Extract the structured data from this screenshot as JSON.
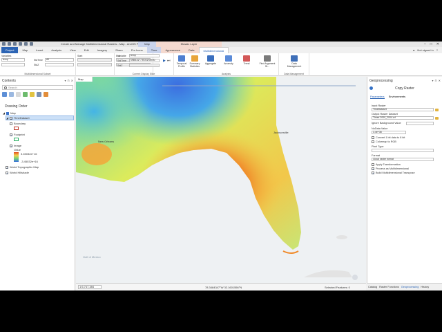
{
  "window": {
    "title": "Create and Manage Multidimensional Rasters - Map - ArcGIS Pro",
    "context_map": "Map",
    "context_mosaic": "Mosaic Layer",
    "controls": [
      "–",
      "□",
      "✕"
    ]
  },
  "tabs": [
    "Project",
    "Map",
    "Insert",
    "Analysis",
    "View",
    "Edit",
    "Imagery",
    "Share",
    "Pro Icons",
    "Time",
    "Appearance",
    "Data",
    "Multidimensional"
  ],
  "tabs_active": "Multidimensional",
  "user": "Not signed in",
  "ribbon": {
    "variables_label": "Variables",
    "variables_value": "temp",
    "stddim_label": "StdTime",
    "stddim_value": "All",
    "stdz_label": "StdZ",
    "start_label": "Start",
    "end_label": "End",
    "group_multidim": "Multidimensional Subset",
    "variable_label": "Variable",
    "variable_value": "temp",
    "time_label": "StdTime",
    "time_value": "1983-12 - 9/1/12:00:00",
    "stdz2_label": "StdZ",
    "group_current": "Current Display Slice",
    "buttons": [
      {
        "label": "Temporal Profile"
      },
      {
        "label": "Summary Statistics"
      },
      {
        "label": "Aggregate"
      },
      {
        "label": "Anomaly"
      },
      {
        "label": "Trend"
      },
      {
        "label": "Find Argument St..."
      }
    ],
    "group_analysis": "Analysis",
    "data_mgmt": "Data Management",
    "group_datamgmt": "Data Management"
  },
  "contents": {
    "title": "Contents",
    "search_placeholder": "Search",
    "draw_order": "Drawing Order",
    "map": "Map",
    "time_dataset": "TimeDataset",
    "boundary": "Boundary",
    "footprint": "Footprint",
    "image": "Image",
    "value": "Value",
    "high": "3.45032e+16",
    "low": "-3.45032e+16",
    "basemap1": "World Topographic Map",
    "basemap2": "World Hillshade"
  },
  "map": {
    "tab": "Map",
    "labels": {
      "city1": "New Orleans",
      "city2": "Jacksonville",
      "city3": "Gulf of Mexico"
    },
    "scale": "1:6,747,384",
    "coords": "78.3484347°W 32.1601556°N",
    "selected": "Selected Features: 0",
    "colors": {
      "cool": "#4a78d0",
      "mid": "#e8ec60",
      "warm": "#e07a28"
    }
  },
  "gp": {
    "title": "Geoprocessing",
    "tool": "Copy Raster",
    "tab_params": "Parameters",
    "tab_env": "Environments",
    "input_label": "Input Raster",
    "input_value": "TimeDataset",
    "output_label": "Output Raster Dataset",
    "output_value": "Times 2000_2004.crf",
    "ignore_label": "Ignore Background Value",
    "nodata_label": "NoData Value",
    "nodata_value": "3.4e+38",
    "convert": "Convert 1 bit data to 8 bit",
    "colormap": "Colormap to RGB",
    "pixel_label": "Pixel Type",
    "format_label": "Format",
    "format_value": "Cloud raster format",
    "apply_transform": "Apply Transformation",
    "process_md": "Process as Multidimensional",
    "build_transpose": "Build Multidimensional Transpose",
    "run": "Run"
  },
  "bottom_tabs": [
    "Catalog",
    "Raster Functions",
    "Geoprocessing",
    "History"
  ],
  "bottom_tabs_active": "Geoprocessing"
}
